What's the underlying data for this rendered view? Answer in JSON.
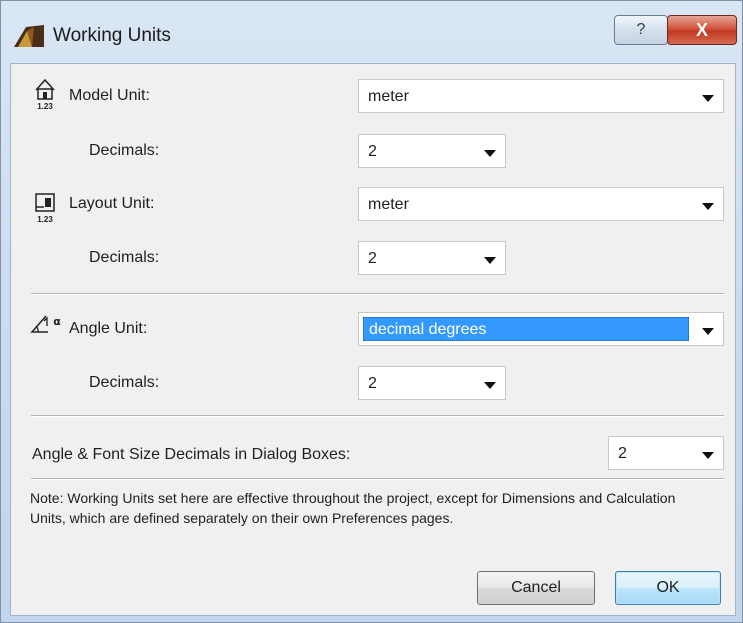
{
  "window": {
    "title": "Working Units",
    "help_symbol": "?",
    "close_symbol": "X"
  },
  "model": {
    "unit_label": "Model Unit:",
    "unit_value": "meter",
    "decimals_label": "Decimals:",
    "decimals_value": "2",
    "icon_caption": "1.23"
  },
  "layout": {
    "unit_label": "Layout Unit:",
    "unit_value": "meter",
    "decimals_label": "Decimals:",
    "decimals_value": "2",
    "icon_caption": "1.23"
  },
  "angle": {
    "unit_label": "Angle Unit:",
    "unit_value": "decimal degrees",
    "decimals_label": "Decimals:",
    "decimals_value": "2",
    "icon_caption": "α"
  },
  "dialog_decimals": {
    "label": "Angle & Font Size Decimals in Dialog Boxes:",
    "value": "2"
  },
  "note": "Note: Working Units set here are effective throughout the project, except for Dimensions and Calculation Units, which are defined separately on their own Preferences pages.",
  "buttons": {
    "cancel": "Cancel",
    "ok": "OK"
  },
  "icons": {
    "app": "archicad-logo-icon",
    "model": "model-unit-icon",
    "layout": "layout-unit-icon",
    "angle": "angle-unit-icon"
  }
}
